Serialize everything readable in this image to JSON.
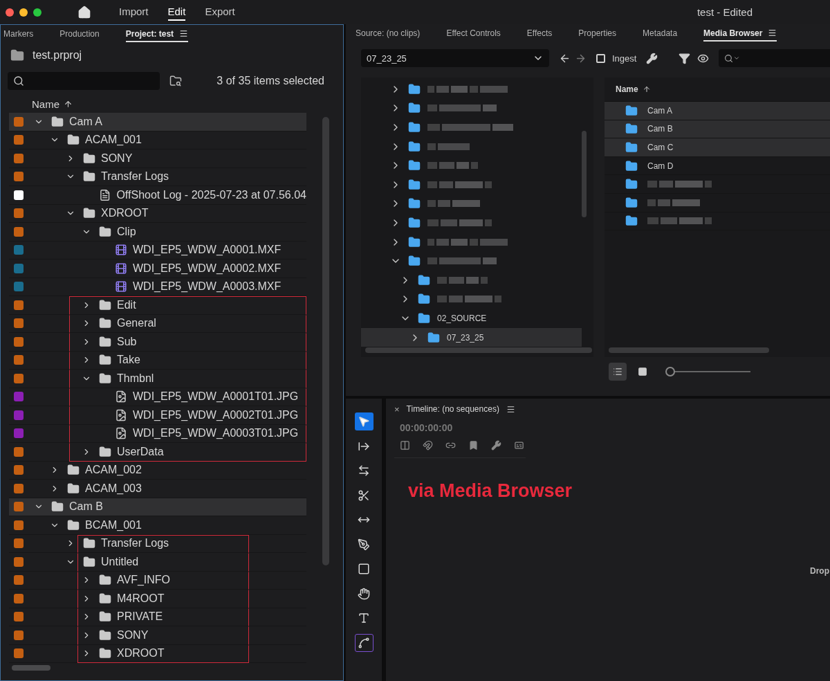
{
  "window": {
    "title": "test - Edited"
  },
  "top_nav": [
    {
      "label": "Import",
      "selected": false
    },
    {
      "label": "Edit",
      "selected": true
    },
    {
      "label": "Export",
      "selected": false
    }
  ],
  "project_panel": {
    "tabs": [
      {
        "label": "Markers",
        "selected": false
      },
      {
        "label": "Production",
        "selected": false
      },
      {
        "label": "Project: test",
        "selected": true
      }
    ],
    "project_name": "test.prproj",
    "selection_count": "3 of 35 items selected",
    "column_header": "Name",
    "tree": [
      {
        "name": "Cam A",
        "kind": "folder",
        "color": "#c45f12",
        "expanded": true,
        "selected": true,
        "boxed": false,
        "children": [
          {
            "name": "ACAM_001",
            "kind": "folder",
            "color": "#c45f12",
            "expanded": true,
            "selected": false,
            "boxed": false,
            "children": [
              {
                "name": "SONY",
                "kind": "folder",
                "color": "#c45f12",
                "expanded": false,
                "selected": false,
                "boxed": false
              },
              {
                "name": "Transfer Logs",
                "kind": "folder",
                "color": "#c45f12",
                "expanded": true,
                "selected": false,
                "boxed": false,
                "children": [
                  {
                    "name": "OffShoot Log - 2025-07-23 at 07.56.04",
                    "kind": "log",
                    "color": "#ffffff",
                    "selected": false,
                    "boxed": false
                  }
                ]
              },
              {
                "name": "XDROOT",
                "kind": "folder",
                "color": "#c45f12",
                "expanded": true,
                "selected": false,
                "boxed": false,
                "children": [
                  {
                    "name": "Clip",
                    "kind": "folder",
                    "color": "#c45f12",
                    "expanded": true,
                    "selected": false,
                    "boxed": false,
                    "children": [
                      {
                        "name": "WDI_EP5_WDW_A0001.MXF",
                        "kind": "clip",
                        "color": "#1a6d8e",
                        "selected": false,
                        "boxed": false
                      },
                      {
                        "name": "WDI_EP5_WDW_A0002.MXF",
                        "kind": "clip",
                        "color": "#1a6d8e",
                        "selected": false,
                        "boxed": false
                      },
                      {
                        "name": "WDI_EP5_WDW_A0003.MXF",
                        "kind": "clip",
                        "color": "#1a6d8e",
                        "selected": false,
                        "boxed": false
                      }
                    ]
                  },
                  {
                    "name": "Edit",
                    "kind": "folder",
                    "color": "#c45f12",
                    "expanded": false,
                    "selected": false,
                    "boxed": true
                  },
                  {
                    "name": "General",
                    "kind": "folder",
                    "color": "#c45f12",
                    "expanded": false,
                    "selected": false,
                    "boxed": true
                  },
                  {
                    "name": "Sub",
                    "kind": "folder",
                    "color": "#c45f12",
                    "expanded": false,
                    "selected": false,
                    "boxed": true
                  },
                  {
                    "name": "Take",
                    "kind": "folder",
                    "color": "#c45f12",
                    "expanded": false,
                    "selected": false,
                    "boxed": true
                  },
                  {
                    "name": "Thmbnl",
                    "kind": "folder",
                    "color": "#c45f12",
                    "expanded": true,
                    "selected": false,
                    "boxed": true,
                    "children": [
                      {
                        "name": "WDI_EP5_WDW_A0001T01.JPG",
                        "kind": "image",
                        "color": "#8c1fb4",
                        "selected": false,
                        "boxed": true
                      },
                      {
                        "name": "WDI_EP5_WDW_A0002T01.JPG",
                        "kind": "image",
                        "color": "#8c1fb4",
                        "selected": false,
                        "boxed": true
                      },
                      {
                        "name": "WDI_EP5_WDW_A0003T01.JPG",
                        "kind": "image",
                        "color": "#8c1fb4",
                        "selected": false,
                        "boxed": true
                      }
                    ]
                  },
                  {
                    "name": "UserData",
                    "kind": "folder",
                    "color": "#c45f12",
                    "expanded": false,
                    "selected": false,
                    "boxed": true
                  }
                ]
              }
            ]
          },
          {
            "name": "ACAM_002",
            "kind": "folder",
            "color": "#c45f12",
            "expanded": false,
            "selected": false,
            "boxed": false
          },
          {
            "name": "ACAM_003",
            "kind": "folder",
            "color": "#c45f12",
            "expanded": false,
            "selected": false,
            "boxed": false
          }
        ]
      },
      {
        "name": "Cam B",
        "kind": "folder",
        "color": "#c45f12",
        "expanded": true,
        "selected": true,
        "boxed": false,
        "children": [
          {
            "name": "BCAM_001",
            "kind": "folder",
            "color": "#c45f12",
            "expanded": true,
            "selected": false,
            "boxed": false,
            "children": [
              {
                "name": "Transfer Logs",
                "kind": "folder",
                "color": "#c45f12",
                "expanded": false,
                "selected": false,
                "boxed": true
              },
              {
                "name": "Untitled",
                "kind": "folder",
                "color": "#c45f12",
                "expanded": true,
                "selected": false,
                "boxed": true,
                "children": [
                  {
                    "name": "AVF_INFO",
                    "kind": "folder",
                    "color": "#c45f12",
                    "expanded": false,
                    "selected": false,
                    "boxed": true
                  },
                  {
                    "name": "M4ROOT",
                    "kind": "folder",
                    "color": "#c45f12",
                    "expanded": false,
                    "selected": false,
                    "boxed": true
                  },
                  {
                    "name": "PRIVATE",
                    "kind": "folder",
                    "color": "#c45f12",
                    "expanded": false,
                    "selected": false,
                    "boxed": true
                  },
                  {
                    "name": "SONY",
                    "kind": "folder",
                    "color": "#c45f12",
                    "expanded": false,
                    "selected": false,
                    "boxed": true
                  },
                  {
                    "name": "XDROOT",
                    "kind": "folder",
                    "color": "#c45f12",
                    "expanded": false,
                    "selected": false,
                    "boxed": true
                  }
                ]
              }
            ]
          }
        ]
      }
    ]
  },
  "source_panel": {
    "tabs": [
      {
        "label": "Source: (no clips)",
        "selected": false
      },
      {
        "label": "Effect Controls",
        "selected": false
      },
      {
        "label": "Effects",
        "selected": false
      },
      {
        "label": "Properties",
        "selected": false
      },
      {
        "label": "Metadata",
        "selected": false
      },
      {
        "label": "Media Browser",
        "selected": true
      }
    ],
    "location": "07_23_25",
    "ingest": {
      "label": "Ingest",
      "checked": false
    },
    "folders": [
      {
        "kind": "redacted",
        "expanded": false,
        "selected": false
      },
      {
        "kind": "redacted",
        "expanded": false,
        "selected": false
      },
      {
        "kind": "redacted",
        "expanded": false,
        "selected": false
      },
      {
        "kind": "redacted",
        "expanded": false,
        "selected": false
      },
      {
        "kind": "redacted",
        "expanded": false,
        "selected": false
      },
      {
        "kind": "redacted",
        "expanded": false,
        "selected": false
      },
      {
        "kind": "redacted",
        "expanded": false,
        "selected": false
      },
      {
        "kind": "redacted",
        "expanded": false,
        "selected": false
      },
      {
        "kind": "redacted",
        "expanded": false,
        "selected": false
      },
      {
        "kind": "redacted",
        "expanded": true,
        "selected": false,
        "children": [
          {
            "kind": "redacted",
            "expanded": false,
            "selected": false
          },
          {
            "kind": "redacted",
            "expanded": false,
            "selected": false
          },
          {
            "kind": "named",
            "name": "02_SOURCE",
            "expanded": true,
            "selected": false,
            "children": [
              {
                "kind": "named",
                "name": "07_23_25",
                "expanded": false,
                "selected": true
              }
            ]
          }
        ]
      }
    ],
    "column_header": "Name",
    "files": [
      {
        "kind": "named",
        "name": "Cam A",
        "selected": true
      },
      {
        "kind": "named",
        "name": "Cam B",
        "selected": true
      },
      {
        "kind": "named",
        "name": "Cam C",
        "selected": true
      },
      {
        "kind": "named",
        "name": "Cam D",
        "selected": false
      },
      {
        "kind": "redacted",
        "selected": false
      },
      {
        "kind": "redacted",
        "selected": false
      },
      {
        "kind": "redacted",
        "selected": false
      }
    ],
    "view_modes": [
      {
        "kind": "list",
        "selected": true
      },
      {
        "kind": "icon",
        "selected": false
      }
    ],
    "zoom": {
      "level": 0
    }
  },
  "tools": [
    {
      "kind": "selection",
      "selected": true,
      "outlined": false
    },
    {
      "kind": "track-select",
      "selected": false,
      "outlined": false
    },
    {
      "kind": "ripple",
      "selected": false,
      "outlined": false
    },
    {
      "kind": "razor",
      "selected": false,
      "outlined": false
    },
    {
      "kind": "slip",
      "selected": false,
      "outlined": false
    },
    {
      "kind": "pen",
      "selected": false,
      "outlined": false
    },
    {
      "kind": "rectangle",
      "selected": false,
      "outlined": false
    },
    {
      "kind": "hand",
      "selected": false,
      "outlined": false
    },
    {
      "kind": "type",
      "selected": false,
      "outlined": false
    },
    {
      "kind": "captions",
      "selected": false,
      "outlined": true
    }
  ],
  "timeline": {
    "close": "×",
    "title": "Timeline: (no sequences)",
    "timecode": "00:00:00:00",
    "annotation": "via Media Browser",
    "drop_hint": "Drop"
  }
}
